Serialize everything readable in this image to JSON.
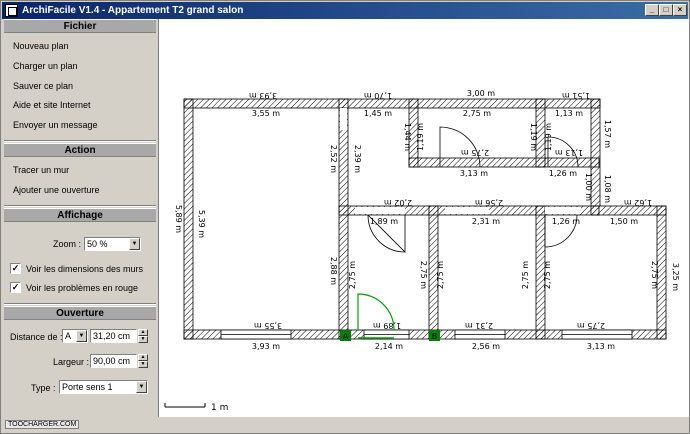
{
  "window": {
    "title": "ArchiFacile V1.4 - Appartement T2 grand salon"
  },
  "sections": {
    "fichier": {
      "title": "Fichier",
      "items": [
        "Nouveau plan",
        "Charger un plan",
        "Sauver ce plan",
        "Aide et site Internet",
        "Envoyer un message"
      ]
    },
    "action": {
      "title": "Action",
      "items": [
        "Tracer un mur",
        "Ajouter une ouverture"
      ]
    },
    "affichage": {
      "title": "Affichage",
      "zoom_label": "Zoom :",
      "zoom_value": "50 %",
      "chk_dims": "Voir les dimensions des murs",
      "chk_problems": "Voir les problèmes en rouge"
    },
    "ouverture": {
      "title": "Ouverture",
      "distance_label": "Distance de :",
      "distance_ref": "A",
      "distance_value": "31,20 cm",
      "largeur_label": "Largeur :",
      "largeur_value": "90,00 cm",
      "type_label": "Type :",
      "type_value": "Porte sens 1"
    }
  },
  "plan": {
    "dims": {
      "top_outer_left": "3,93 m",
      "top_inner_left": "3,55 m",
      "top_outer_mid": "1,70 m",
      "top_inner_mid": "1,45 m",
      "top_outer_r1": "3,00 m",
      "top_inner_r1": "2,75 m",
      "top_outer_r2": "1,51 m",
      "top_inner_r2": "1,13 m",
      "left_outer": "5,89 m",
      "left_inner": "5,39 m",
      "corr_left_outer": "2,52 m",
      "corr_left_inner": "2,39 m",
      "corr_right_inner": "1,44 m",
      "wc_left": "1,19 m",
      "bath_right": "1,19 m",
      "cl_left": "1,19 m",
      "cl_right": "1,57 m",
      "bath_door": "2,75 m",
      "bath_bottom": "3,13 m",
      "cl_inner": "1,13 m",
      "cl_bottom": "1,26 m",
      "cl_v": "1,00 m",
      "cl_v2": "1,08 m",
      "mid_a": "2,02 m",
      "mid_b": "2,56 m",
      "mid_c": "1,62 m",
      "r1_top": "1,89 m",
      "r2_top": "2,31 m",
      "r3_top": "1,26 m",
      "r3_top2": "1,50 m",
      "r1_left_o": "2,88 m",
      "r1_left_i": "2,75 m",
      "r1_right": "2,75 m",
      "r2_left": "2,75 m",
      "r2_right": "2,75 m",
      "r3_left": "2,75 m",
      "r3_right": "2,75 m",
      "r3_right_o": "3,25 m",
      "bot_in_1": "3,55 m",
      "bot_in_2": "1,89 m",
      "bot_in_3": "2,31 m",
      "bot_in_4": "2,75 m",
      "bot_out_1": "3,93 m",
      "bot_out_2": "2,14 m",
      "bot_out_3": "2,56 m",
      "bot_out_4": "3,13 m"
    },
    "markers": {
      "a": "A",
      "b": "B"
    },
    "scale": "1 m"
  },
  "status": {
    "watermark": "TOOCHARGER.COM"
  },
  "colors": {
    "titlebar": "#0a246a",
    "door_active": "#00a000",
    "wall": "#000000"
  }
}
